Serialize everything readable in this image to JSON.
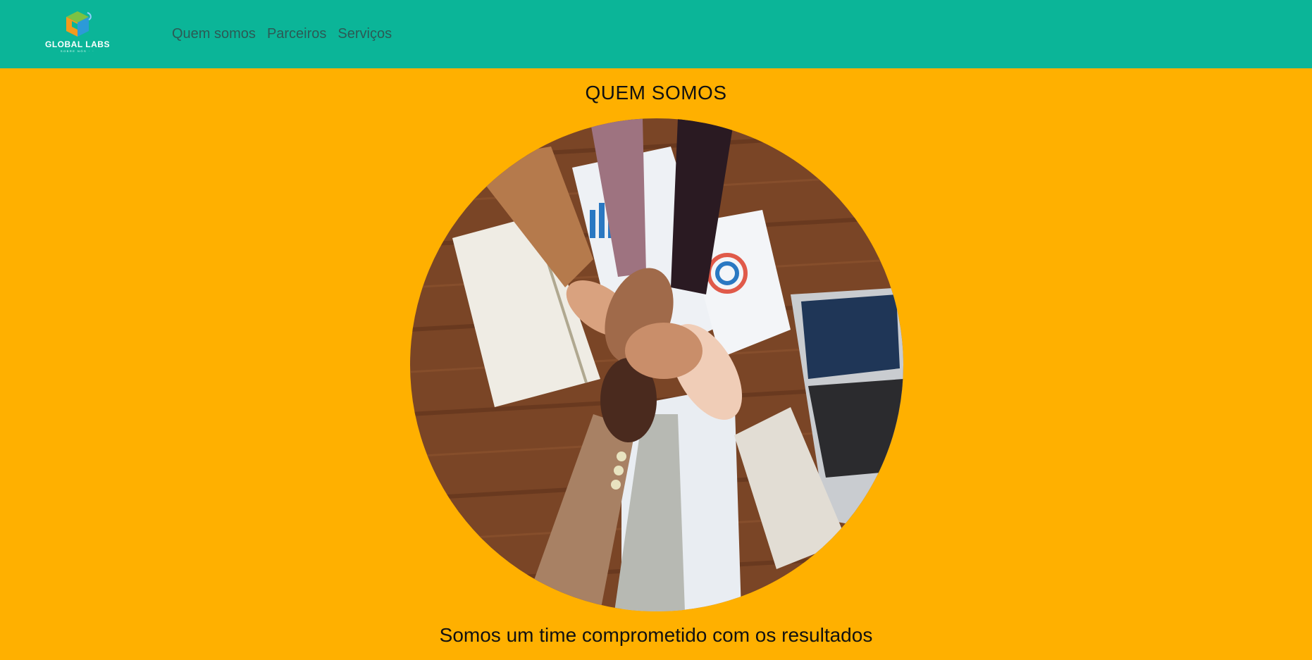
{
  "header": {
    "brand": "GLOBAL LABS",
    "brand_sub": "SOBRE NÓS · ·",
    "logo_icon": "cube-logo-icon",
    "background": "#0BB598",
    "nav": [
      {
        "label": "Quem somos"
      },
      {
        "label": "Parceiros"
      },
      {
        "label": "Serviços"
      }
    ]
  },
  "main": {
    "background": "#FFB000",
    "title": "QUEM SOMOS",
    "image_subject": "team-hands-together-photo",
    "caption": "Somos um time comprometido com os resultados"
  }
}
